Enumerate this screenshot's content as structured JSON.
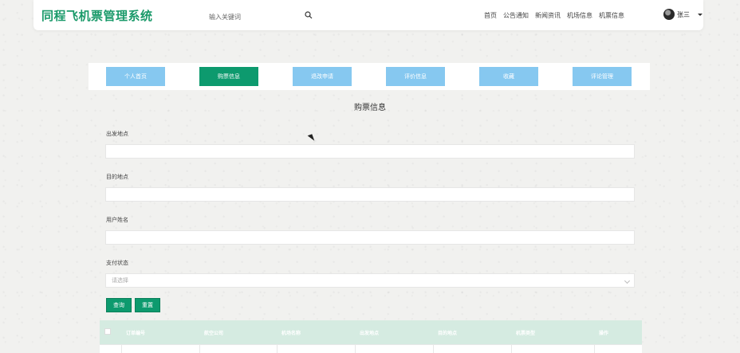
{
  "header": {
    "app_title": "同程飞机票管理系统",
    "search_placeholder": "输入关键词",
    "nav": [
      "首页",
      "公告通知",
      "新闻资讯",
      "机场信息",
      "机票信息"
    ],
    "user_name": "张三"
  },
  "tabs": [
    {
      "label": "个人首页",
      "active": false
    },
    {
      "label": "购票信息",
      "active": true
    },
    {
      "label": "退改申请",
      "active": false
    },
    {
      "label": "评价信息",
      "active": false
    },
    {
      "label": "收藏",
      "active": false
    },
    {
      "label": "评论管理",
      "active": false
    }
  ],
  "page_title": "购票信息",
  "form": {
    "departure_label": "出发地点",
    "destination_label": "目的地点",
    "user_name_label": "用户姓名",
    "pay_status_label": "支付状态",
    "pay_status_placeholder": "请选择"
  },
  "buttons": {
    "search": "查询",
    "reset": "重置"
  },
  "table": {
    "headers": [
      "订单编号",
      "航空公司",
      "机场名称",
      "出发地点",
      "目的地点",
      "机票类型",
      "操作"
    ]
  },
  "colors": {
    "brand": "#1a9a6a",
    "active_tab": "#0d9a6e",
    "tab": "#86c8f0"
  }
}
